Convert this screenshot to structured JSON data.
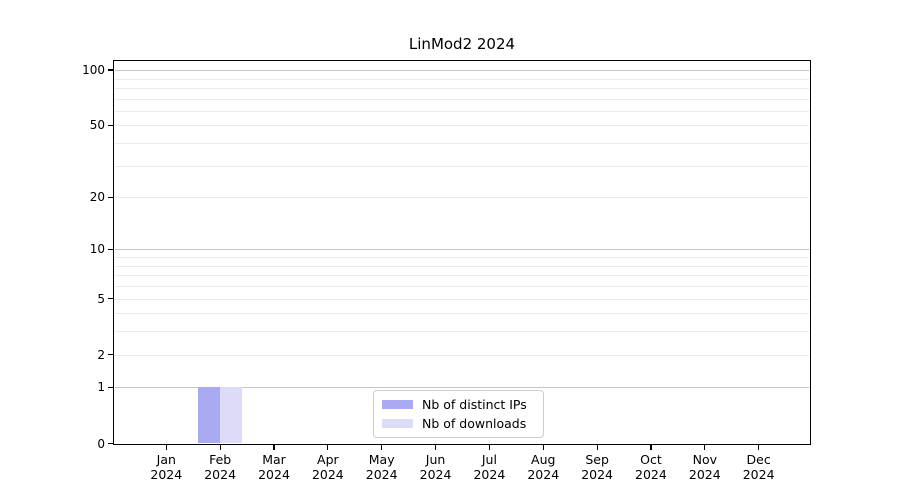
{
  "title": "LinMod2 2024",
  "chart_data": {
    "type": "bar",
    "title": "LinMod2 2024",
    "categories": [
      {
        "month": "Jan",
        "year": "2024"
      },
      {
        "month": "Feb",
        "year": "2024"
      },
      {
        "month": "Mar",
        "year": "2024"
      },
      {
        "month": "Apr",
        "year": "2024"
      },
      {
        "month": "May",
        "year": "2024"
      },
      {
        "month": "Jun",
        "year": "2024"
      },
      {
        "month": "Jul",
        "year": "2024"
      },
      {
        "month": "Aug",
        "year": "2024"
      },
      {
        "month": "Sep",
        "year": "2024"
      },
      {
        "month": "Oct",
        "year": "2024"
      },
      {
        "month": "Nov",
        "year": "2024"
      },
      {
        "month": "Dec",
        "year": "2024"
      }
    ],
    "series": [
      {
        "name": "Nb of distinct IPs",
        "color": "#aaaaf2",
        "values": [
          0,
          1,
          0,
          0,
          0,
          0,
          0,
          0,
          0,
          0,
          0,
          0
        ]
      },
      {
        "name": "Nb of downloads",
        "color": "#dcdcf8",
        "values": [
          0,
          1,
          0,
          0,
          0,
          0,
          0,
          0,
          0,
          0,
          0,
          0
        ]
      }
    ],
    "yscale": "log10(1+y)",
    "ylim": [
      0,
      112
    ],
    "yticks": [
      100,
      50,
      20,
      10,
      5,
      2,
      1,
      0
    ],
    "grid": {
      "major": [
        1,
        10,
        100
      ],
      "minor": [
        2,
        3,
        4,
        5,
        6,
        7,
        8,
        9,
        20,
        30,
        40,
        50,
        60,
        70,
        80,
        90
      ],
      "major_color": "#c6c6c6",
      "minor_color": "#ebebeb"
    },
    "legend_position": "bottom-center",
    "xlabel": "",
    "ylabel": ""
  }
}
